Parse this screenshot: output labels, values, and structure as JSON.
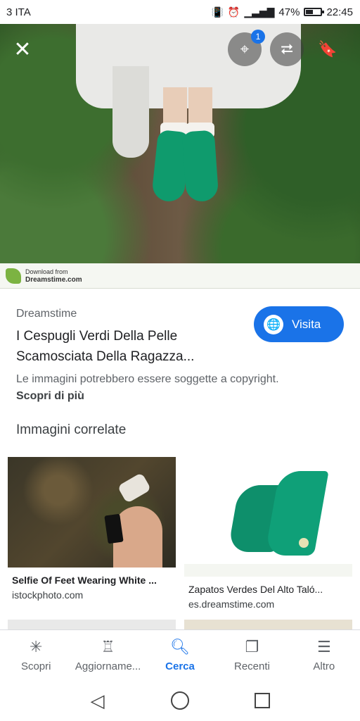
{
  "status_bar": {
    "carrier": "3 ITA",
    "battery_percent": "47%",
    "battery_level": 0.47,
    "time": "22:45",
    "icons": [
      "vibrate-icon",
      "alarm-icon",
      "signal-4g-icon",
      "battery-icon"
    ]
  },
  "image_viewer": {
    "lens_badge_count": "1",
    "actions": [
      "close-icon",
      "lens-icon",
      "share-icon",
      "bookmark-icon"
    ],
    "watermark": {
      "line1": "Download from",
      "line2": "Dreamstime.com"
    }
  },
  "result": {
    "source": "Dreamstime",
    "title": "I Cespugli Verdi Della Pelle Scamosciata Della Ragazza...",
    "visit_label": "Visita",
    "copyright_notice": "Le immagini potrebbero essere soggette a copyright.",
    "learn_more": "Scopri di più"
  },
  "related": {
    "heading": "Immagini correlate",
    "items": [
      {
        "title": "Selfie Of Feet Wearing White ...",
        "site": "istockphoto.com"
      },
      {
        "title": "Zapatos Verdes Del Alto Taló...",
        "site": "es.dreamstime.com"
      }
    ]
  },
  "bottom_nav": {
    "items": [
      {
        "label": "Scopri",
        "icon": "asterisk-icon"
      },
      {
        "label": "Aggiorname...",
        "icon": "updates-icon"
      },
      {
        "label": "Cerca",
        "icon": "search-icon"
      },
      {
        "label": "Recenti",
        "icon": "recent-tabs-icon"
      },
      {
        "label": "Altro",
        "icon": "menu-icon"
      }
    ],
    "active_index": 2
  },
  "colors": {
    "accent": "#1a73e8",
    "shoe_green": "#0f9b6d"
  }
}
